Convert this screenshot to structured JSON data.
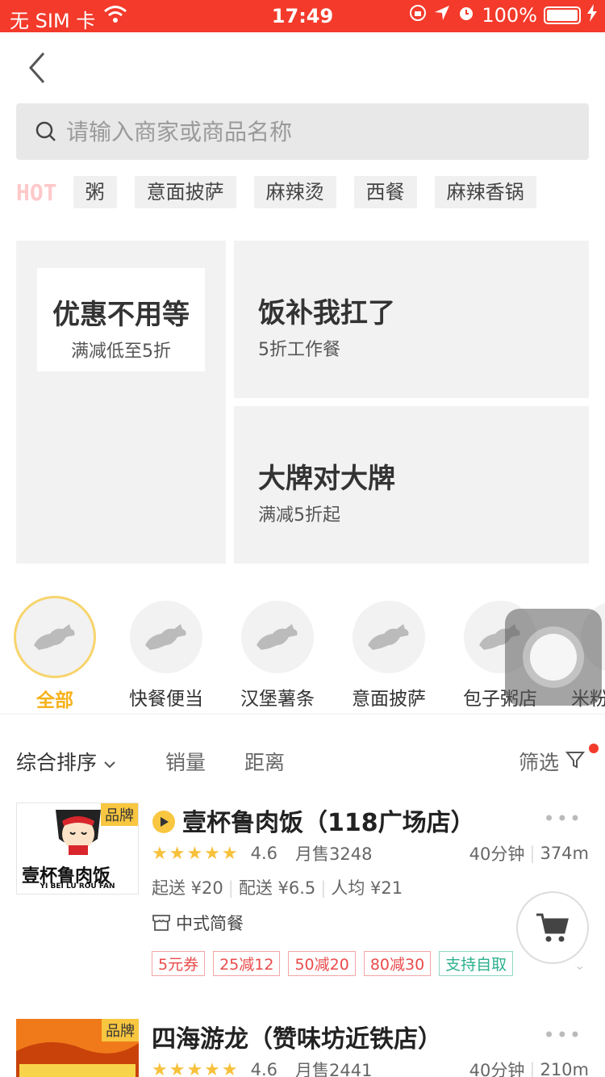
{
  "status_bar": {
    "carrier": "无 SIM 卡",
    "time": "17:49",
    "battery": "100%"
  },
  "search": {
    "placeholder": "请输入商家或商品名称"
  },
  "hot": {
    "label": "HOT",
    "tags": [
      "粥",
      "意面披萨",
      "麻辣烫",
      "西餐",
      "麻辣香锅"
    ]
  },
  "promos": [
    {
      "title": "优惠不用等",
      "subtitle": "满减低至5折"
    },
    {
      "title": "饭补我扛了",
      "subtitle": "5折工作餐"
    },
    {
      "title": "大牌对大牌",
      "subtitle": "满减5折起"
    }
  ],
  "categories": [
    "全部",
    "快餐便当",
    "汉堡薯条",
    "意面披萨",
    "包子粥店",
    "米粉"
  ],
  "sort": {
    "default": "综合排序",
    "sales": "销量",
    "distance": "距离",
    "filter": "筛选"
  },
  "shops": [
    {
      "name": "壹杯鲁肉饭（118广场店）",
      "brand_badge": "品牌",
      "logo_text": "壹杯鲁肉饭",
      "logo_sub": "YI BEI LU ROU FAN",
      "rating": "4.6",
      "monthly_sales": "月售3248",
      "time": "40分钟",
      "distance": "374m",
      "min_order": "起送 ¥20",
      "delivery_fee": "配送 ¥6.5",
      "avg_price": "人均 ¥21",
      "category": "中式简餐",
      "tags": [
        "5元券",
        "25减12",
        "50减20",
        "80减30",
        "支持自取"
      ]
    },
    {
      "name": "四海游龙（赞味坊近铁店）",
      "brand_badge": "品牌",
      "rating": "4.6",
      "monthly_sales": "月售2441",
      "time": "40分钟",
      "distance": "210m"
    }
  ],
  "colors": {
    "accent": "#f33a2b",
    "active": "#f6b21b",
    "star": "#f8c13b"
  }
}
